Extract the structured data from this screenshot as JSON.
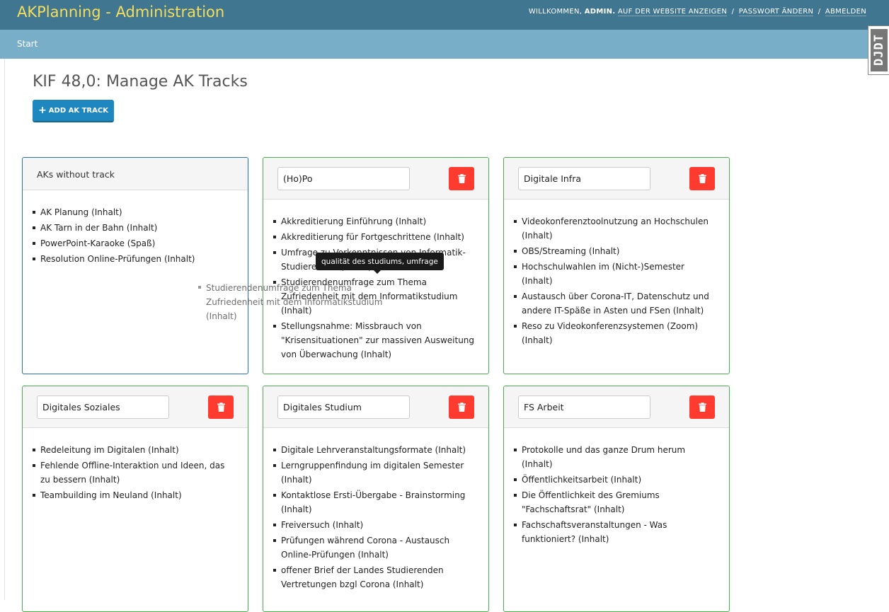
{
  "header": {
    "title": "AKPlanning - Administration",
    "welcome_text": "WILLKOMMEN,",
    "username": "ADMIN.",
    "view_site": "AUF DER WEBSITE ANZEIGEN",
    "change_password": "PASSWORT ÄNDERN",
    "logout": "ABMELDEN",
    "separator": "/"
  },
  "breadcrumbs": {
    "start": "Start"
  },
  "debug_toolbar": {
    "label": "DJDT"
  },
  "page": {
    "title": "KIF 48,0: Manage AK Tracks",
    "add_button_label": "ADD AK TRACK"
  },
  "untracked": {
    "title": "AKs without track",
    "items": [
      "AK Planung (Inhalt)",
      "AK Tarn in der Bahn (Inhalt)",
      "PowerPoint-Karaoke (Spaß)",
      "Resolution Online-Prüfungen (Inhalt)"
    ]
  },
  "tracks": [
    {
      "name": "(Ho)Po",
      "items": [
        "Akkreditierung Einführung (Inhalt)",
        "Akkreditierung für Fortgeschrittene (Inhalt)",
        "Umfrage zu Vorkenntnissen von Informatik-Studierenden (Inhalt)",
        "Studierendenumfrage zum Thema Zufriedenheit mit dem Informatikstudium (Inhalt)",
        "Stellungsnahme: Missbrauch von \"Krisensituationen\" zur massiven Ausweitung von Überwachung (Inhalt)"
      ]
    },
    {
      "name": "Digitale Infra",
      "items": [
        "Videokonferenztoolnutzung an Hochschulen (Inhalt)",
        "OBS/Streaming (Inhalt)",
        "Hochschulwahlen im (Nicht-)Semester (Inhalt)",
        "Austausch über Corona-IT, Datenschutz und andere IT-Späße in Asten und FSen (Inhalt)",
        "Reso zu Videokonferenzsystemen (Zoom) (Inhalt)"
      ]
    },
    {
      "name": "Digitales Soziales",
      "items": [
        "Redeleitung im Digitalen (Inhalt)",
        "Fehlende Offline-Interaktion und Ideen, das zu bessern (Inhalt)",
        "Teambuilding im Neuland (Inhalt)"
      ]
    },
    {
      "name": "Digitales Studium",
      "items": [
        "Digitale Lehrveranstaltungsformate (Inhalt)",
        "Lerngruppenfindung im digitalen Semester (Inhalt)",
        "Kontaktlose Ersti-Übergabe - Brainstorming (Inhalt)",
        "Freiversuch (Inhalt)",
        "Prüfungen während Corona - Austausch Online-Prüfungen (Inhalt)",
        "offener Brief der Landes Studierenden Vertretungen bzgl Corona (Inhalt)"
      ]
    },
    {
      "name": "FS Arbeit",
      "items": [
        "Protokolle und das ganze Drum herum (Inhalt)",
        "Öffentlichkeitsarbeit (Inhalt)",
        "Die Öffentlichkeit des Gremiums \"Fachschaftsrat\" (Inhalt)",
        "Fachschaftsveranstaltungen - Was funktioniert? (Inhalt)"
      ]
    }
  ],
  "drag_ghost": "Studierendenumfrage zum Thema Zufriedenheit mit dem Informatikstudium (Inhalt)",
  "tooltip": "qualität des studiums, umfrage",
  "colors": {
    "header_bg": "#417690",
    "branding": "#f5dd5d",
    "breadcrumbs_bg": "#79aec8",
    "primary_button": "#1e87c0",
    "delete_button": "#ff3b30",
    "track_border": "#46b04a",
    "untracked_border": "#2a6fb7"
  }
}
